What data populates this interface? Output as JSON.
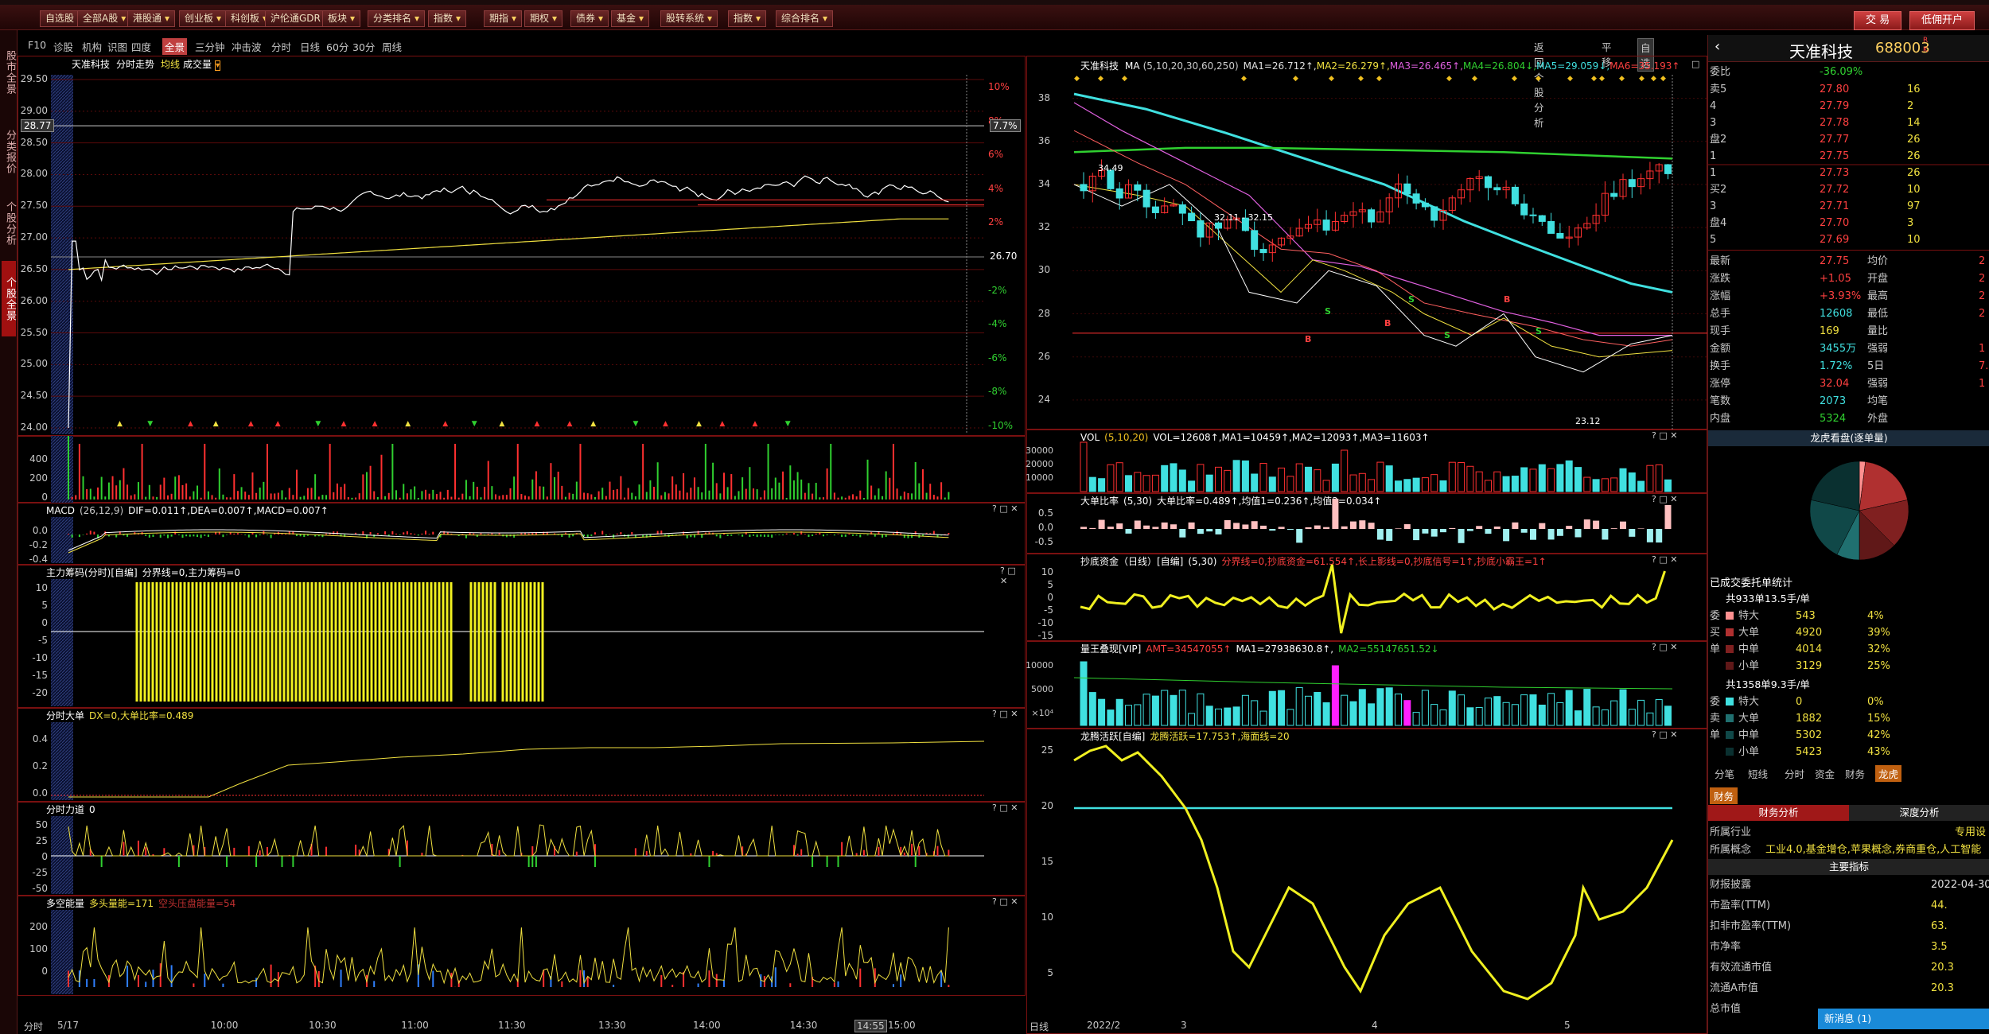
{
  "topbar": {
    "buttons": [
      "自选股",
      "全部A股",
      "港股通",
      "创业板",
      "科创板",
      "沪伦通GDR",
      "板块",
      "分类排名",
      "指数",
      "期指",
      "期权",
      "债券",
      "基金",
      "股转系统",
      "指数",
      "综合排名"
    ],
    "trade": "交 易",
    "open_account": "低佣开户"
  },
  "sidebar": [
    "股市全景",
    "分类报价",
    "个股分析",
    "个股全景"
  ],
  "subnav": {
    "items": [
      "F10",
      "诊股",
      "机构",
      "识图",
      "四度",
      "全景",
      "三分钟",
      "冲击波",
      "分时",
      "日线",
      "60分",
      "30分",
      "周线"
    ],
    "selected": "全景",
    "right": [
      "返回个股分析",
      "平移",
      "自选"
    ]
  },
  "left": {
    "stock": "天准科技",
    "chart_name": "分时走势",
    "avg": "均线",
    "vol": "成交量",
    "price_ticks": [
      "29.50",
      "29.00",
      "28.50",
      "28.00",
      "27.50",
      "27.00",
      "26.50",
      "26.00",
      "25.50",
      "25.00",
      "24.50",
      "24.00"
    ],
    "pct_ticks": [
      "10%",
      "8%",
      "6%",
      "4%",
      "2%",
      "-2%",
      "-4%",
      "-6%",
      "-8%",
      "-10%"
    ],
    "pre_close": "26.70",
    "cur_price": "28.77",
    "cur_pct": "7.7%",
    "vol_ticks": [
      "400",
      "200",
      "0"
    ],
    "macd_label": "MACD",
    "macd_params": "(26,12,9)",
    "macd_vals": "DIF=0.011↑,DEA=0.007↑,MACD=0.007↑",
    "macd_ticks": [
      "0.0",
      "-0.2",
      "-0.4"
    ],
    "zlcm": "主力筹码(分时)[自编]",
    "zlcm_vals": "分界线=0,主力筹码=0",
    "zlcm_ticks": [
      "10",
      "5",
      "0",
      "-5",
      "-10",
      "-15",
      "-20"
    ],
    "fsdd": "分时大单",
    "fsdd_vals": "DX=0,大单比率=0.489",
    "fsdd_ticks": [
      "0.4",
      "0.2",
      "0.0"
    ],
    "fsld": "分时力道",
    "fsld_vals": "0",
    "fsld_ticks": [
      "50",
      "25",
      "0",
      "-25",
      "-50"
    ],
    "dkn": "多空能量",
    "dkn_vals": "多头量能=171",
    "dkn_red": "空头压盘能量=54",
    "dkn_ticks": [
      "200",
      "100",
      "0"
    ],
    "x_labels": [
      "分时",
      "5/17",
      "10:00",
      "10:30",
      "11:00",
      "11:30",
      "13:30",
      "14:00",
      "14:30",
      "14:55",
      "15:00"
    ]
  },
  "mid": {
    "stock": "天准科技",
    "ma_label": "MA",
    "ma_params": "(5,10,20,30,60,250)",
    "ma_vals": [
      {
        "t": "MA1=26.712↑,",
        "c": "#e0e0e0"
      },
      {
        "t": "MA2=26.279↑,",
        "c": "#f0e040"
      },
      {
        "t": "MA3=26.465↑,",
        "c": "#e060e0"
      },
      {
        "t": "MA4=26.804↓,",
        "c": "#30d030"
      },
      {
        "t": "MA5=29.059↓,",
        "c": "#40e0e0"
      },
      {
        "t": "MA6=35.193↑",
        "c": "#ff4040"
      }
    ],
    "price_ticks": [
      "38",
      "36",
      "34",
      "32",
      "30",
      "28",
      "26",
      "24"
    ],
    "annot": {
      "hi": "34.49",
      "mid": "32.11 - 32.15",
      "lo": "23.12"
    },
    "vol": "VOL",
    "vol_params": "(5,10,20)",
    "vol_vals": "VOL=12608↑,MA1=10459↑,MA2=12093↑,MA3=11603↑",
    "vol_ticks": [
      "30000",
      "20000",
      "10000"
    ],
    "ddbl": "大单比率",
    "ddbl_params": "(5,30)",
    "ddbl_vals": "大单比率=0.489↑,均值1=0.236↑,均值2=0.034↑",
    "ddbl_ticks": [
      "0.5",
      "0.0",
      "-0.5"
    ],
    "cdzj": "抄底资金（日线）[自编]",
    "cdzj_params": "(5,30)",
    "cdzj_vals": "分界线=0,抄底资金=61.554↑,长上影线=0,抄底信号=1↑,抄底小霸王=1↑",
    "cdzj_ticks": [
      "10",
      "5",
      "0",
      "-5",
      "-10",
      "-15"
    ],
    "ljdx": "量王叠现[VIP]",
    "ljdx_vals1": "AMT=34547055↑",
    "ljdx_vals2": "MA1=27938630.8↑,",
    "ljdx_vals3": "MA2=55147651.52↓",
    "ljdx_ticks": [
      "10000",
      "5000",
      "×10⁴"
    ],
    "lthy": "龙腾活跃[自编]",
    "lthy_vals": "龙腾活跃=17.753↑,海面线=20",
    "lthy_ticks": [
      "25",
      "20",
      "15",
      "10",
      "5"
    ],
    "x_labels": [
      "日线",
      "2022/2",
      "3",
      "4",
      "5"
    ]
  },
  "right": {
    "name": "天准科技",
    "code": "688003",
    "badge_r": "R",
    "badge_k": "K",
    "weibi_l": "委比",
    "weibi": "-36.09%",
    "asks": [
      {
        "l": "卖5",
        "p": "27.80",
        "v": "16"
      },
      {
        "l": "4",
        "p": "27.79",
        "v": "2"
      },
      {
        "l": "3",
        "p": "27.78",
        "v": "14"
      },
      {
        "l": "盘2",
        "p": "27.77",
        "v": "26"
      },
      {
        "l": "1",
        "p": "27.75",
        "v": "26"
      }
    ],
    "bids": [
      {
        "l": "1",
        "p": "27.73",
        "v": "26"
      },
      {
        "l": "买2",
        "p": "27.72",
        "v": "10"
      },
      {
        "l": "3",
        "p": "27.71",
        "v": "97"
      },
      {
        "l": "盘4",
        "p": "27.70",
        "v": "3"
      },
      {
        "l": "5",
        "p": "27.69",
        "v": "10"
      }
    ],
    "stats": [
      {
        "l": "最新",
        "v": "27.75",
        "c": "red",
        "l2": "均价",
        "v2": "2"
      },
      {
        "l": "涨跌",
        "v": "+1.05",
        "c": "red",
        "l2": "开盘",
        "v2": "2"
      },
      {
        "l": "涨幅",
        "v": "+3.93%",
        "c": "red",
        "l2": "最高",
        "v2": "2"
      },
      {
        "l": "总手",
        "v": "12608",
        "c": "cyan",
        "l2": "最低",
        "v2": "2"
      },
      {
        "l": "现手",
        "v": "169",
        "c": "yellow",
        "l2": "量比",
        "v2": ""
      },
      {
        "l": "金额",
        "v": "3455万",
        "c": "cyan",
        "l2": "强弱",
        "v2": "1"
      },
      {
        "l": "换手",
        "v": "1.72%",
        "c": "cyan",
        "l2": "5日",
        "v2": "7."
      },
      {
        "l": "涨停",
        "v": "32.04",
        "c": "red",
        "l2": "强弱",
        "v2": "1"
      },
      {
        "l": "笔数",
        "v": "2073",
        "c": "cyan",
        "l2": "均笔",
        "v2": ""
      },
      {
        "l": "内盘",
        "v": "5324",
        "c": "green",
        "l2": "外盘",
        "v2": ""
      }
    ],
    "pie_title": "龙虎看盘(逐单量)",
    "deal_title": "已成交委托单统计",
    "buy_total": "共933单13.5手/单",
    "buy_rows": [
      {
        "l": "特大",
        "v": "543",
        "p": "4%"
      },
      {
        "l": "大单",
        "v": "4920",
        "p": "39%"
      },
      {
        "l": "中单",
        "v": "4014",
        "p": "32%"
      },
      {
        "l": "小单",
        "v": "3129",
        "p": "25%"
      }
    ],
    "buy_side": [
      "委",
      "买",
      "单"
    ],
    "sell_total": "共1358单9.3手/单",
    "sell_rows": [
      {
        "l": "特大",
        "v": "0",
        "p": "0%"
      },
      {
        "l": "大单",
        "v": "1882",
        "p": "15%"
      },
      {
        "l": "中单",
        "v": "5302",
        "p": "42%"
      },
      {
        "l": "小单",
        "v": "5423",
        "p": "43%"
      }
    ],
    "sell_side": [
      "委",
      "卖",
      "单"
    ],
    "tabs": [
      "分笔",
      "短线",
      "分时",
      "资金",
      "财务",
      "龙虎"
    ],
    "tab_sel": "龙虎",
    "fin_tab": "财务",
    "fin_tabs": [
      "财务分析",
      "深度分析"
    ],
    "industry_l": "所属行业",
    "industry": "专用设",
    "concept_l": "所属概念",
    "concept": "工业4.0,基金增仓,苹果概念,券商重仓,人工智能",
    "main_idx": "主要指标",
    "fin_rows": [
      {
        "l": "财报披露",
        "v": "2022-04-30"
      },
      {
        "l": "市盈率(TTM)",
        "v": "44."
      },
      {
        "l": "扣非市盈率(TTM)",
        "v": "63."
      },
      {
        "l": "市净率",
        "v": "3.5"
      },
      {
        "l": "有效流通市值",
        "v": "20.3"
      },
      {
        "l": "流通A市值",
        "v": "20.3"
      },
      {
        "l": "总市值",
        "v": ""
      }
    ],
    "news": "新消息 (1)"
  },
  "colors": {
    "up": "#ff3030",
    "down": "#30e0e0",
    "grid": "#7a1010",
    "price": "#ffffff",
    "avg": "#f0e040"
  }
}
